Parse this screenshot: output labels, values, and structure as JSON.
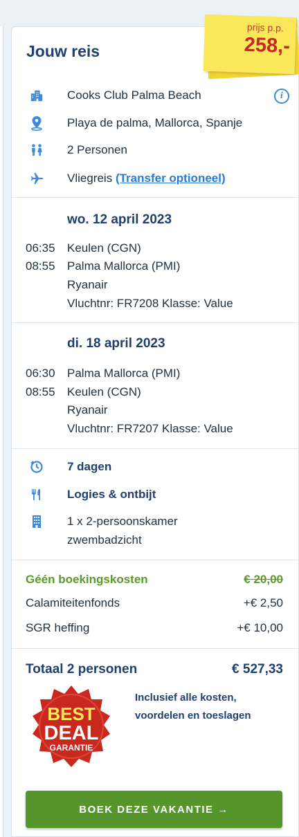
{
  "card": {
    "title": "Jouw reis"
  },
  "price_sticker": {
    "label": "prijs p.p.",
    "price": "258,-"
  },
  "summary": {
    "hotel": "Cooks Club Palma Beach",
    "location": "Playa de palma, Mallorca, Spanje",
    "persons": "2 Personen",
    "transport": "Vliegreis",
    "transfer_link": "(Transfer optioneel)"
  },
  "outbound": {
    "date": "wo. 12 april 2023",
    "dep_time": "06:35",
    "arr_time": "08:55",
    "from": "Keulen (CGN)",
    "to": "Palma Mallorca (PMI)",
    "airline": "Ryanair",
    "flight": "Vluchtnr: FR7208 Klasse: Value"
  },
  "return": {
    "date": "di. 18 april 2023",
    "dep_time": "06:30",
    "arr_time": "08:55",
    "from": "Palma Mallorca (PMI)",
    "to": "Keulen (CGN)",
    "airline": "Ryanair",
    "flight": "Vluchtnr: FR7207 Klasse: Value"
  },
  "stay": {
    "duration": "7 dagen",
    "board": "Logies & ontbijt",
    "room_line1": "1 x 2-persoonskamer",
    "room_line2": "zwembadzicht"
  },
  "costs": {
    "booking_label": "Géén boekingskosten",
    "booking_value": "€ 20,00",
    "calamity_label": "Calamiteitenfonds",
    "calamity_value": "+€ 2,50",
    "sgr_label": "SGR heffing",
    "sgr_value": "+€ 10,00"
  },
  "total": {
    "label": "Totaal 2 personen",
    "value": "€ 527,33",
    "note": "Inclusief alle kosten, voordelen en toeslagen"
  },
  "badge": {
    "line1": "BEST",
    "line2": "DEAL",
    "line3": "GARANTIE"
  },
  "cta": {
    "label": "BOEK DEZE VAKANTIE →"
  },
  "colors": {
    "primary": "#1f3f6e",
    "accent_blue": "#2a7bd1",
    "green": "#55952b",
    "sticker": "#fbe85a",
    "badge_red": "#c8281e"
  }
}
